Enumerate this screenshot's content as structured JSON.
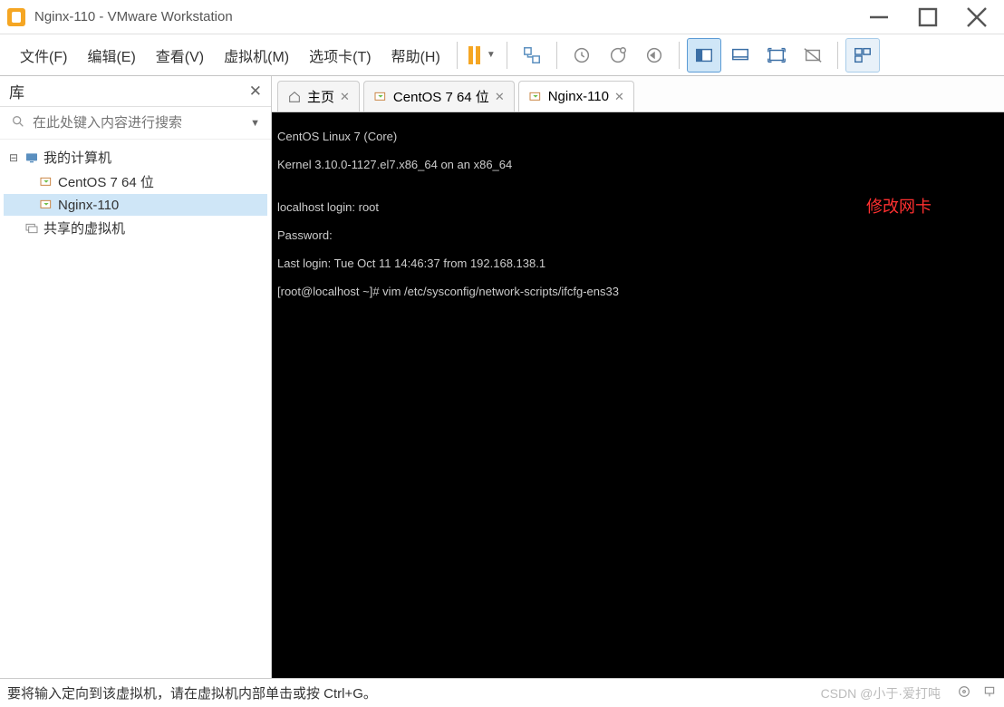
{
  "titlebar": {
    "title": "Nginx-110 - VMware Workstation"
  },
  "menu": {
    "file": "文件(F)",
    "edit": "编辑(E)",
    "view": "查看(V)",
    "vm": "虚拟机(M)",
    "tabs": "选项卡(T)",
    "help": "帮助(H)"
  },
  "sidebar": {
    "header": "库",
    "search_placeholder": "在此处键入内容进行搜索",
    "root": "我的计算机",
    "items": [
      "CentOS 7 64 位",
      "Nginx-110"
    ],
    "shared": "共享的虚拟机"
  },
  "tabs": {
    "home": "主页",
    "centos": "CentOS 7 64 位",
    "nginx": "Nginx-110"
  },
  "terminal": {
    "l1": "CentOS Linux 7 (Core)",
    "l2": "Kernel 3.10.0-1127.el7.x86_64 on an x86_64",
    "l3": "",
    "l4": "localhost login: root",
    "l5": "Password:",
    "l6": "Last login: Tue Oct 11 14:46:37 from 192.168.138.1",
    "l7": "[root@localhost ~]# vim /etc/sysconfig/network-scripts/ifcfg-ens33",
    "annotation": "修改网卡"
  },
  "statusbar": {
    "text": "要将输入定向到该虚拟机，请在虚拟机内部单击或按 Ctrl+G。",
    "watermark": "CSDN @小于·爱打吨"
  }
}
